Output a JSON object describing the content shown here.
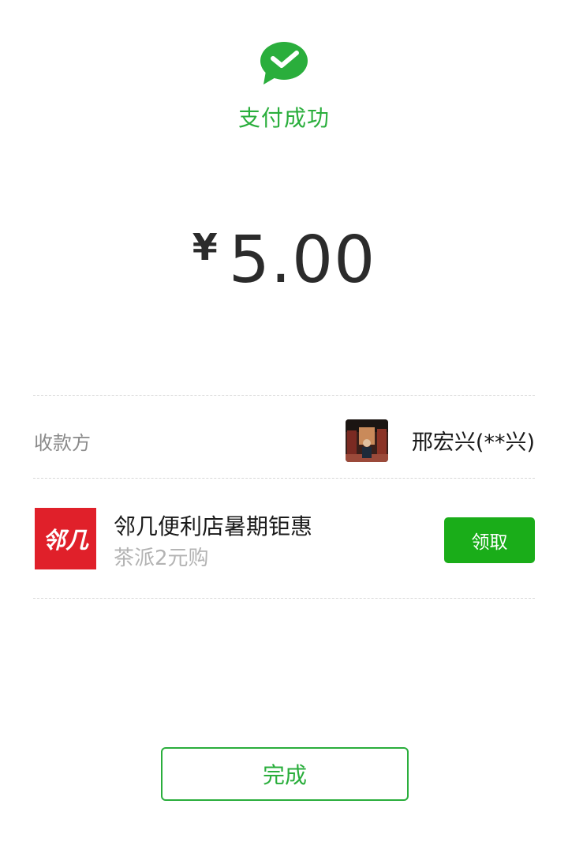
{
  "header": {
    "icon": "wechat-pay-check-icon",
    "status": "支付成功",
    "accent_color": "#2aae3c"
  },
  "payment": {
    "currency_symbol": "¥",
    "amount": "5.00"
  },
  "payee": {
    "label": "收款方",
    "avatar": "payee-avatar-photo",
    "name": "邢宏兴(**兴)"
  },
  "promotion": {
    "logo_text": "邻几",
    "logo_color": "#e0202a",
    "title": "邻几便利店暑期钜惠",
    "subtitle": "茶派2元购",
    "claim_label": "领取",
    "claim_color": "#1aad19"
  },
  "footer": {
    "done_label": "完成"
  }
}
